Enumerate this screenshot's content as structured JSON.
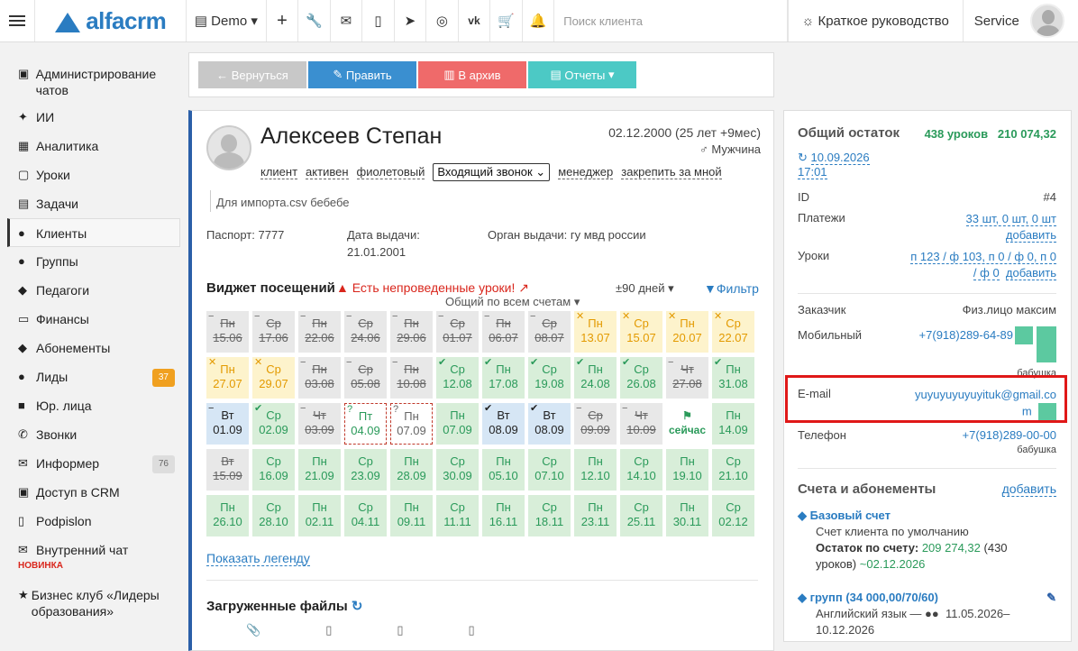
{
  "topbar": {
    "logo": "alfacrm",
    "branch": "Demo",
    "icons": [
      "plus-icon",
      "wrench-icon",
      "mail-icon",
      "phone-icon",
      "telegram-icon",
      "whatsapp-icon",
      "vk-icon",
      "cart-icon",
      "bell-icon"
    ],
    "search_placeholder": "Поиск клиента",
    "guide": "Краткое руководство",
    "user": "Service"
  },
  "sidebar": {
    "items": [
      {
        "label": "Администрирование чатов",
        "icon": "chat-icon"
      },
      {
        "label": "ИИ",
        "icon": "sparkle-icon"
      },
      {
        "label": "Аналитика",
        "icon": "map-icon"
      },
      {
        "label": "Уроки",
        "icon": "calendar-icon"
      },
      {
        "label": "Задачи",
        "icon": "tasks-icon"
      },
      {
        "label": "Клиенты",
        "icon": "user-icon"
      },
      {
        "label": "Группы",
        "icon": "users-icon"
      },
      {
        "label": "Педагоги",
        "icon": "graduation-icon"
      },
      {
        "label": "Финансы",
        "icon": "money-icon"
      },
      {
        "label": "Абонементы",
        "icon": "tag-icon"
      },
      {
        "label": "Лиды",
        "icon": "user-plus-icon",
        "badge": "37"
      },
      {
        "label": "Юр. лица",
        "icon": "briefcase-icon"
      },
      {
        "label": "Звонки",
        "icon": "phone-icon"
      },
      {
        "label": "Информер",
        "icon": "envelope-icon",
        "badge": "76"
      },
      {
        "label": "Доступ в CRM",
        "icon": "lock-icon"
      },
      {
        "label": "Podpislon",
        "icon": "file-icon"
      },
      {
        "label": "Внутренний чат",
        "icon": "mail-icon",
        "tag": "НОВИНКА"
      },
      {
        "label": "Бизнес клуб «Лидеры образования»",
        "icon": "star-icon"
      }
    ]
  },
  "actions": {
    "back": "Вернуться",
    "edit": "Править",
    "archive": "В архив",
    "reports": "Отчеты"
  },
  "client": {
    "name": "Алексеев Степан",
    "dob": "02.12.2000 (25 лет +9мес)",
    "gender": "Мужчина",
    "tags": [
      "клиент",
      "активен",
      "фиолетовый"
    ],
    "call_type": "Входящий звонок",
    "manager": "менеджер",
    "pin": "закрепить за мной",
    "note": "Для импорта.csv бебебе",
    "passport_label": "Паспорт:",
    "passport": "7777",
    "issue_label": "Дата выдачи:",
    "issue_date": "21.01.2001",
    "authority_label": "Орган выдачи:",
    "authority": "гу мвд россии"
  },
  "widget": {
    "title": "Виджет посещений",
    "warning": "Есть непроведенные уроки!",
    "period": "±90 дней",
    "filter": "Фильтр",
    "account": "Общий по всем счетам",
    "legend": "Показать легенду",
    "cells": [
      {
        "d": "Пн",
        "dt": "15.06",
        "s": "gray",
        "i": "−"
      },
      {
        "d": "Ср",
        "dt": "17.06",
        "s": "gray",
        "i": "−"
      },
      {
        "d": "Пн",
        "dt": "22.06",
        "s": "gray",
        "i": "−"
      },
      {
        "d": "Ср",
        "dt": "24.06",
        "s": "gray",
        "i": "−"
      },
      {
        "d": "Пн",
        "dt": "29.06",
        "s": "gray",
        "i": "−"
      },
      {
        "d": "Ср",
        "dt": "01.07",
        "s": "gray",
        "i": "−"
      },
      {
        "d": "Пн",
        "dt": "06.07",
        "s": "gray",
        "i": "−"
      },
      {
        "d": "Ср",
        "dt": "08.07",
        "s": "gray",
        "i": "−"
      },
      {
        "d": "Пн",
        "dt": "13.07",
        "s": "yellow",
        "i": "✕"
      },
      {
        "d": "Ср",
        "dt": "15.07",
        "s": "yellow",
        "i": "✕"
      },
      {
        "d": "Пн",
        "dt": "20.07",
        "s": "yellow",
        "i": "✕"
      },
      {
        "d": "Ср",
        "dt": "22.07",
        "s": "yellow",
        "i": "✕"
      },
      {
        "d": "Пн",
        "dt": "27.07",
        "s": "yellow",
        "i": "✕"
      },
      {
        "d": "Ср",
        "dt": "29.07",
        "s": "yellow",
        "i": "✕"
      },
      {
        "d": "Пн",
        "dt": "03.08",
        "s": "gray",
        "i": "−"
      },
      {
        "d": "Ср",
        "dt": "05.08",
        "s": "gray",
        "i": "−"
      },
      {
        "d": "Пн",
        "dt": "10.08",
        "s": "gray",
        "i": "−"
      },
      {
        "d": "Ср",
        "dt": "12.08",
        "s": "green",
        "i": "✔"
      },
      {
        "d": "Пн",
        "dt": "17.08",
        "s": "green",
        "i": "✔"
      },
      {
        "d": "Ср",
        "dt": "19.08",
        "s": "green",
        "i": "✔"
      },
      {
        "d": "Пн",
        "dt": "24.08",
        "s": "green",
        "i": "✔"
      },
      {
        "d": "Ср",
        "dt": "26.08",
        "s": "green",
        "i": "✔"
      },
      {
        "d": "Чт",
        "dt": "27.08",
        "s": "gray",
        "i": "−"
      },
      {
        "d": "Пн",
        "dt": "31.08",
        "s": "green",
        "i": "✔"
      },
      {
        "d": "Вт",
        "dt": "01.09",
        "s": "blue",
        "i": "−"
      },
      {
        "d": "Ср",
        "dt": "02.09",
        "s": "green",
        "i": "✔"
      },
      {
        "d": "Чт",
        "dt": "03.09",
        "s": "gray",
        "i": "−"
      },
      {
        "d": "Пт",
        "dt": "04.09",
        "s": "red",
        "i": "?"
      },
      {
        "d": "Пн",
        "dt": "07.09",
        "s": "gray2",
        "i": "?"
      },
      {
        "d": "Пн",
        "dt": "07.09",
        "s": "green",
        "i": ""
      },
      {
        "d": "Вт",
        "dt": "08.09",
        "s": "blue",
        "i": "✔"
      },
      {
        "d": "Вт",
        "dt": "08.09",
        "s": "blue",
        "i": "✔"
      },
      {
        "d": "Ср",
        "dt": "09.09",
        "s": "gray",
        "i": "−"
      },
      {
        "d": "Чт",
        "dt": "10.09",
        "s": "gray",
        "i": "−"
      },
      {
        "d": "",
        "dt": "сейчас",
        "s": "now",
        "i": ""
      },
      {
        "d": "Пн",
        "dt": "14.09",
        "s": "green",
        "i": ""
      },
      {
        "d": "Вт",
        "dt": "15.09",
        "s": "gray",
        "i": ""
      },
      {
        "d": "Ср",
        "dt": "16.09",
        "s": "green",
        "i": ""
      },
      {
        "d": "Пн",
        "dt": "21.09",
        "s": "green",
        "i": ""
      },
      {
        "d": "Ср",
        "dt": "23.09",
        "s": "green",
        "i": ""
      },
      {
        "d": "Пн",
        "dt": "28.09",
        "s": "green",
        "i": ""
      },
      {
        "d": "Ср",
        "dt": "30.09",
        "s": "green",
        "i": ""
      },
      {
        "d": "Пн",
        "dt": "05.10",
        "s": "green",
        "i": ""
      },
      {
        "d": "Ср",
        "dt": "07.10",
        "s": "green",
        "i": ""
      },
      {
        "d": "Пн",
        "dt": "12.10",
        "s": "green",
        "i": ""
      },
      {
        "d": "Ср",
        "dt": "14.10",
        "s": "green",
        "i": ""
      },
      {
        "d": "Пн",
        "dt": "19.10",
        "s": "green",
        "i": ""
      },
      {
        "d": "Ср",
        "dt": "21.10",
        "s": "green",
        "i": ""
      },
      {
        "d": "Пн",
        "dt": "26.10",
        "s": "green",
        "i": ""
      },
      {
        "d": "Ср",
        "dt": "28.10",
        "s": "green",
        "i": ""
      },
      {
        "d": "Пн",
        "dt": "02.11",
        "s": "green",
        "i": ""
      },
      {
        "d": "Ср",
        "dt": "04.11",
        "s": "green",
        "i": ""
      },
      {
        "d": "Пн",
        "dt": "09.11",
        "s": "green",
        "i": ""
      },
      {
        "d": "Ср",
        "dt": "11.11",
        "s": "green",
        "i": ""
      },
      {
        "d": "Пн",
        "dt": "16.11",
        "s": "green",
        "i": ""
      },
      {
        "d": "Ср",
        "dt": "18.11",
        "s": "green",
        "i": ""
      },
      {
        "d": "Пн",
        "dt": "23.11",
        "s": "green",
        "i": ""
      },
      {
        "d": "Ср",
        "dt": "25.11",
        "s": "green",
        "i": ""
      },
      {
        "d": "Пн",
        "dt": "30.11",
        "s": "green",
        "i": ""
      },
      {
        "d": "Ср",
        "dt": "02.12",
        "s": "green",
        "i": ""
      }
    ]
  },
  "files": {
    "title": "Загруженные файлы"
  },
  "summary": {
    "balance_label": "Общий остаток",
    "lessons": "438 уроков",
    "amount": "210 074,32",
    "updated_date": "10.09.2026",
    "updated_time": "17:01",
    "id_label": "ID",
    "id": "#4",
    "payments_label": "Платежи",
    "payments": "33 шт, 0 шт, 0 шт",
    "payments_add": "добавить",
    "lessons_label": "Уроки",
    "lessons_val1": "п 123 / ф 103, п 0 / ф 0, п 0",
    "lessons_val2": "/ ф 0",
    "lessons_add": "добавить",
    "customer_label": "Заказчик",
    "customer": "Физ.лицо максим",
    "mobile_label": "Мобильный",
    "mobile": "+7(918)289-64-89",
    "mobile_note": "бабушка",
    "email_label": "E-mail",
    "email1": "yuyuyuyuyuyituk@gmail.co",
    "email2": "m",
    "phone_label": "Телефон",
    "phone": "+7(918)289-00-00",
    "phone_note": "бабушка",
    "accounts_title": "Счета и абонементы",
    "accounts_add": "добавить",
    "base_account": "Базовый счет",
    "base_desc": "Счет клиента по умолчанию",
    "remaining_label": "Остаток по счету:",
    "remaining": "209 274,32",
    "remaining_lessons": "(430",
    "remaining_lessons2": "уроков)",
    "remaining_date": "~02.12.2026",
    "group": "групп (34 000,00/70/60)",
    "group_lang": "Английский язык —",
    "group_dates": "11.05.2026–",
    "group_end": "10.12.2026"
  }
}
